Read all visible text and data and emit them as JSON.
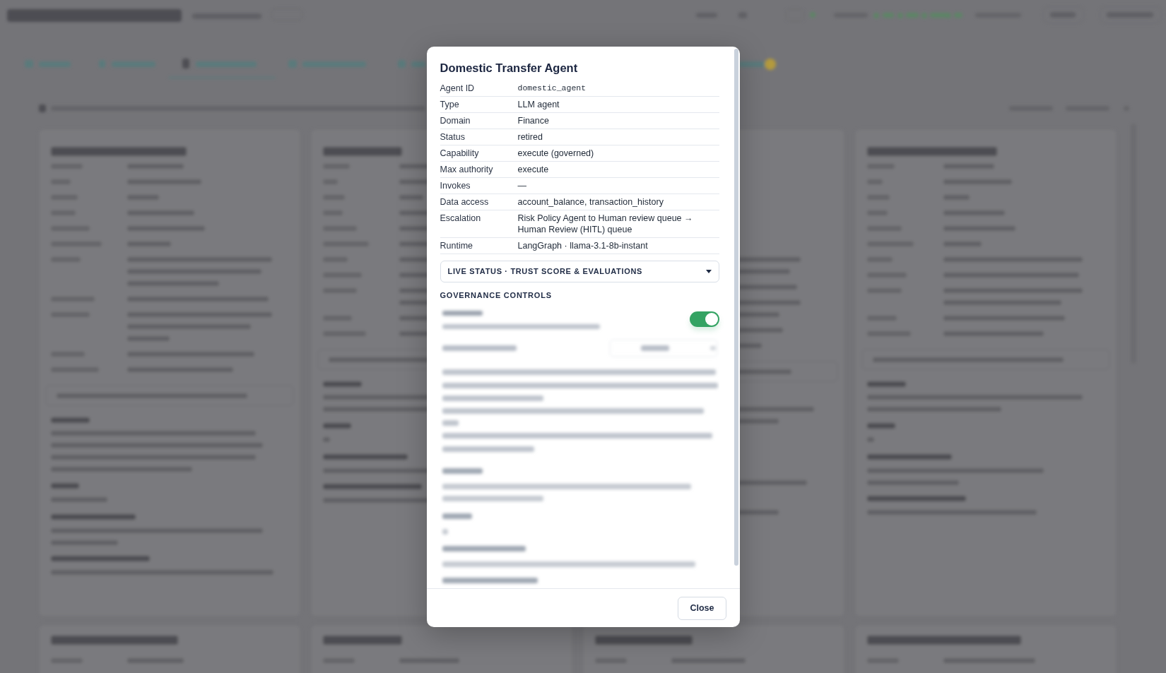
{
  "agent_modal": {
    "title": "Domestic Transfer Agent",
    "fields": [
      {
        "label": "Agent ID",
        "value": "domestic_agent",
        "kind": "code"
      },
      {
        "label": "Type",
        "value": "LLM agent",
        "kind": "text"
      },
      {
        "label": "Domain",
        "value": "Finance",
        "kind": "text"
      },
      {
        "label": "Status",
        "value": "retired",
        "kind": "text"
      },
      {
        "label": "Capability",
        "value": "execute (governed)",
        "kind": "text"
      },
      {
        "label": "Max authority",
        "value": "execute",
        "kind": "text"
      },
      {
        "label": "Invokes",
        "value": "—",
        "kind": "text"
      },
      {
        "label": "Data access",
        "value": "account_balance, transaction_history",
        "kind": "text"
      },
      {
        "label": "Escalation",
        "value": "Risk Policy Agent to Human review queue → Human Review (HITL) queue",
        "kind": "text"
      },
      {
        "label": "Runtime",
        "value": "LangGraph · llama-3.1-8b-instant",
        "kind": "text"
      }
    ],
    "live_status_section": {
      "label": "LIVE STATUS · TRUST SCORE & EVALUATIONS",
      "expanded": false
    },
    "governance_controls": {
      "heading": "GOVERNANCE CONTROLS",
      "toggle": {
        "on": true
      }
    },
    "close_button": "Close"
  }
}
